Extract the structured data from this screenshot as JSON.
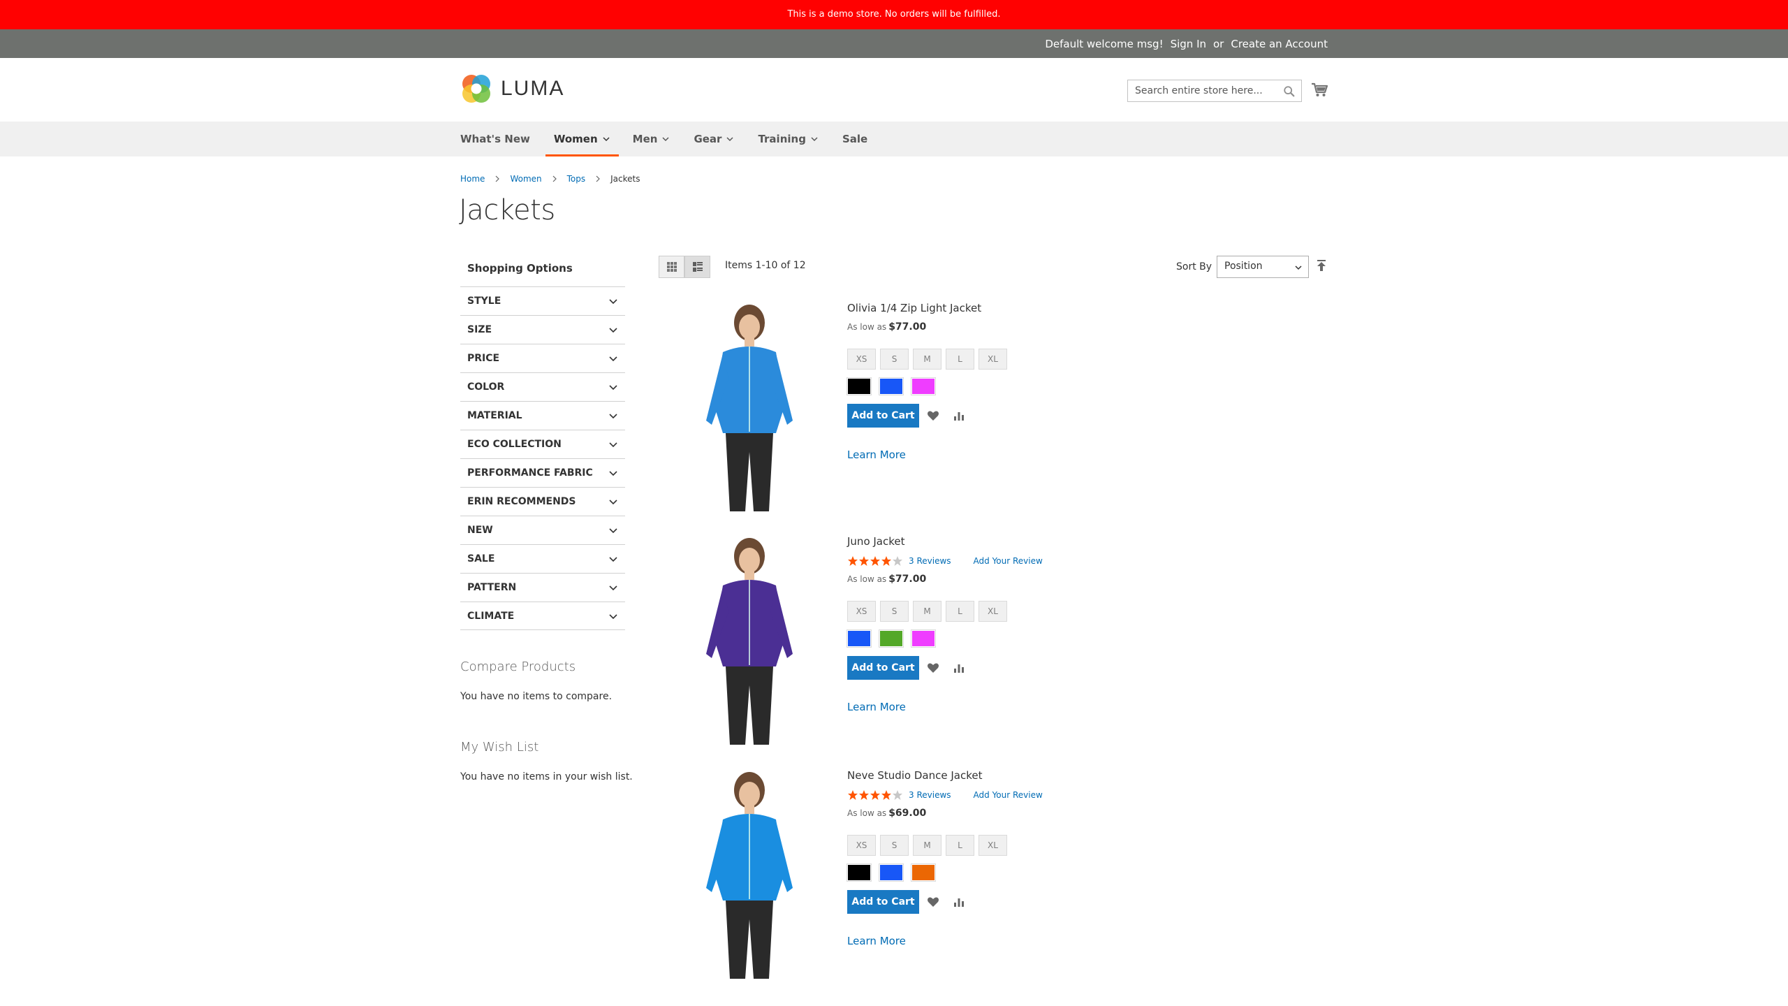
{
  "demo_banner": "This is a demo store. No orders will be fulfilled.",
  "top_links": {
    "welcome": "Default welcome msg!",
    "sign_in": "Sign In",
    "or": "or",
    "create_account": "Create an Account"
  },
  "logo": {
    "text": "LUMA"
  },
  "search": {
    "placeholder": "Search entire store here..."
  },
  "nav": [
    {
      "label": "What's New",
      "has_dropdown": false
    },
    {
      "label": "Women",
      "has_dropdown": true,
      "active": true
    },
    {
      "label": "Men",
      "has_dropdown": true
    },
    {
      "label": "Gear",
      "has_dropdown": true
    },
    {
      "label": "Training",
      "has_dropdown": true
    },
    {
      "label": "Sale",
      "has_dropdown": false
    }
  ],
  "breadcrumb": [
    "Home",
    "Women",
    "Tops",
    "Jackets"
  ],
  "page_title": "Jackets",
  "sidebar": {
    "title": "Shopping Options",
    "filters": [
      "STYLE",
      "SIZE",
      "PRICE",
      "COLOR",
      "MATERIAL",
      "ECO COLLECTION",
      "PERFORMANCE FABRIC",
      "ERIN RECOMMENDS",
      "NEW",
      "SALE",
      "PATTERN",
      "CLIMATE"
    ],
    "compare_title": "Compare Products",
    "compare_text": "You have no items to compare.",
    "wishlist_title": "My Wish List",
    "wishlist_text": "You have no items in your wish list."
  },
  "toolbar": {
    "amount": "Items 1-10 of 12",
    "sort_label": "Sort By",
    "sort_value": "Position"
  },
  "colors": {
    "banner": "#ff0101",
    "accent": "#1979c3",
    "link": "#006bb4",
    "nav_active": "#ff5501",
    "star": "#ff5501"
  },
  "products": [
    {
      "name": "Olivia 1/4 Zip Light Jacket",
      "rating_stars": null,
      "reviews_count": null,
      "add_review": null,
      "price_prefix": "As low as",
      "price": "$77.00",
      "sizes": [
        "XS",
        "S",
        "M",
        "L",
        "XL"
      ],
      "swatches": [
        "#000000",
        "#1857f7",
        "#ef3dff"
      ],
      "add_to_cart": "Add to Cart",
      "learn_more": "Learn More",
      "jacket_color": "#2b8bdb"
    },
    {
      "name": "Juno Jacket",
      "rating_stars": 4,
      "reviews_count": "3  Reviews",
      "add_review": "Add Your Review",
      "price_prefix": "As low as",
      "price": "$77.00",
      "sizes": [
        "XS",
        "S",
        "M",
        "L",
        "XL"
      ],
      "swatches": [
        "#1857f7",
        "#53a828",
        "#ef3dff"
      ],
      "add_to_cart": "Add to Cart",
      "learn_more": "Learn More",
      "jacket_color": "#4b2f94"
    },
    {
      "name": "Neve Studio Dance Jacket",
      "rating_stars": 4,
      "reviews_count": "3  Reviews",
      "add_review": "Add Your Review",
      "price_prefix": "As low as",
      "price": "$69.00",
      "sizes": [
        "XS",
        "S",
        "M",
        "L",
        "XL"
      ],
      "swatches": [
        "#000000",
        "#1857f7",
        "#eb6703"
      ],
      "add_to_cart": "Add to Cart",
      "learn_more": "Learn More",
      "jacket_color": "#1a8ee0"
    }
  ]
}
